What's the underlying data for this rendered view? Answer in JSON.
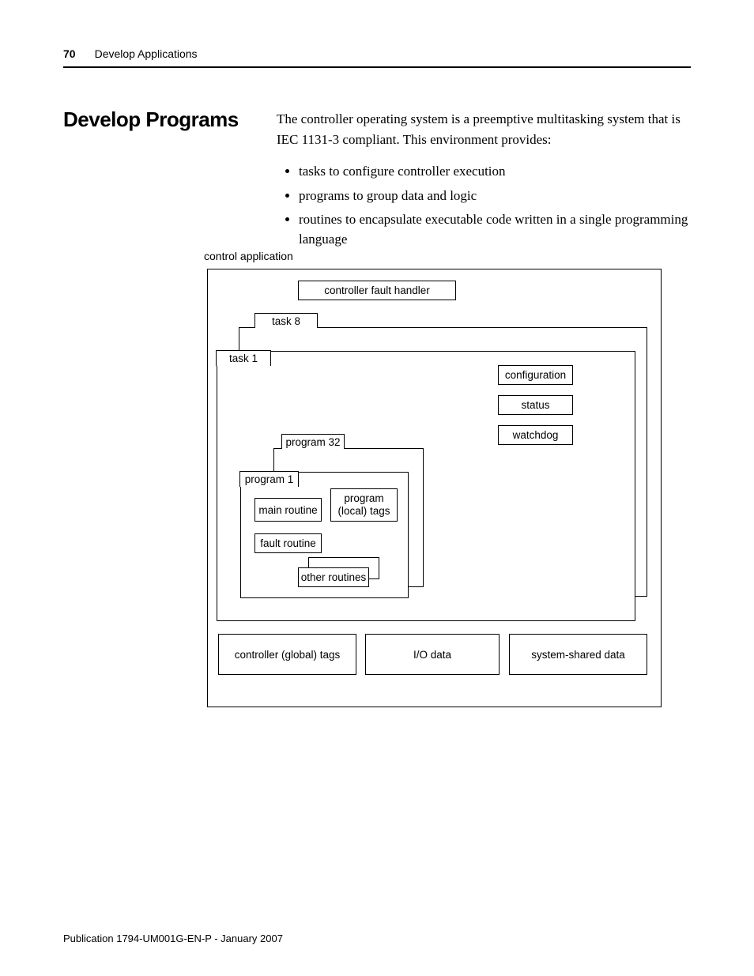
{
  "header": {
    "page_number": "70",
    "chapter": "Develop Applications"
  },
  "section_title": "Develop Programs",
  "intro_paragraph": "The controller operating system is a preemptive multitasking system that is IEC 1131-3 compliant. This environment provides:",
  "bullets": [
    "tasks to configure controller execution",
    "programs to group data and logic",
    "routines to encapsulate executable code written in a single programming language"
  ],
  "diagram": {
    "title": "control application",
    "controller_fault_handler": "controller fault handler",
    "task_8": "task 8",
    "task_1": "task 1",
    "configuration": "configuration",
    "status": "status",
    "watchdog": "watchdog",
    "program_32": "program 32",
    "program_1": "program 1",
    "main_routine": "main routine",
    "program_local_tags": "program (local) tags",
    "fault_routine": "fault routine",
    "other_routines": "other routines",
    "controller_global_tags": "controller (global) tags",
    "io_data": "I/O data",
    "system_shared_data": "system-shared data"
  },
  "footer": "Publication 1794-UM001G-EN-P - January 2007"
}
